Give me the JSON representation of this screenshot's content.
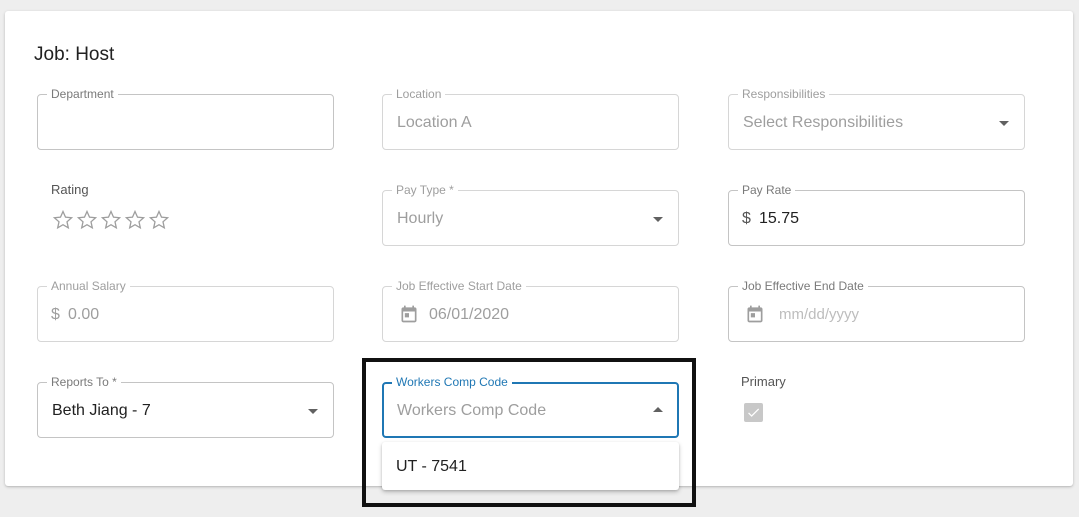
{
  "card": {
    "title": "Job: Host"
  },
  "fields": {
    "department": {
      "label": "Department",
      "value": ""
    },
    "location": {
      "label": "Location",
      "value": "Location A"
    },
    "responsibilities": {
      "label": "Responsibilities",
      "placeholder": "Select Responsibilities"
    },
    "rating": {
      "label": "Rating",
      "value": 0,
      "max": 5
    },
    "pay_type": {
      "label": "Pay Type *",
      "value": "Hourly"
    },
    "pay_rate": {
      "label": "Pay Rate",
      "prefix": "$",
      "value": "15.75"
    },
    "annual_salary": {
      "label": "Annual Salary",
      "prefix": "$",
      "value": "0.00"
    },
    "job_start": {
      "label": "Job Effective Start Date",
      "value": "06/01/2020"
    },
    "job_end": {
      "label": "Job Effective End Date",
      "placeholder": "mm/dd/yyyy"
    },
    "reports_to": {
      "label": "Reports To *",
      "value": "Beth Jiang - 7"
    },
    "workers_comp": {
      "label": "Workers Comp Code",
      "placeholder": "Workers Comp Code",
      "options": [
        "UT - 7541"
      ]
    },
    "primary": {
      "label": "Primary",
      "checked": true
    }
  },
  "colors": {
    "focus": "#1f77b4",
    "highlight_border": "#111111"
  }
}
